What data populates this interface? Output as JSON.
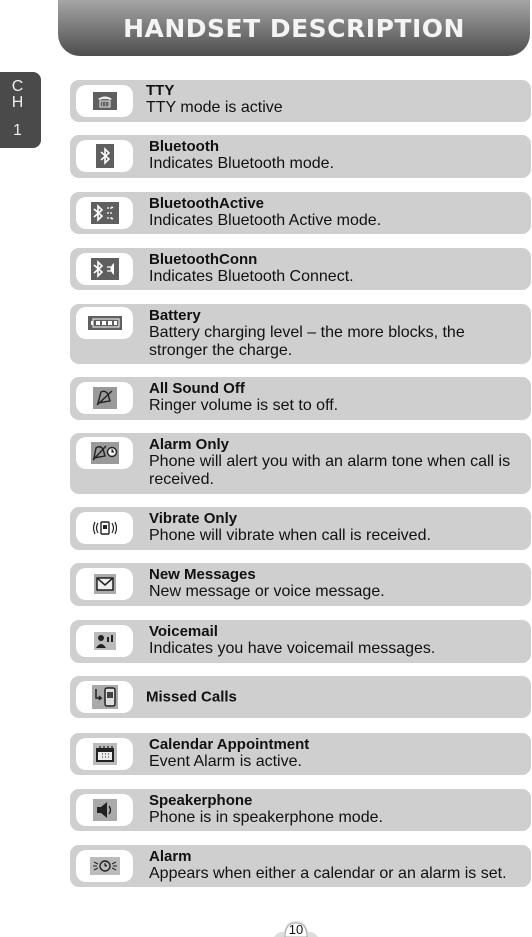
{
  "header": {
    "title": "HANDSET DESCRIPTION"
  },
  "chapter_tab": {
    "line1": "C",
    "line2": "H",
    "line3": "1"
  },
  "items": [
    {
      "icon": "tty-icon",
      "title": "TTY",
      "desc": "TTY mode is active"
    },
    {
      "icon": "bluetooth-icon",
      "title": "Bluetooth",
      "desc": "Indicates Bluetooth mode."
    },
    {
      "icon": "bluetooth-active-icon",
      "title": "BluetoothActive",
      "desc": "Indicates Bluetooth Active mode."
    },
    {
      "icon": "bluetooth-connect-icon",
      "title": "BluetoothConn",
      "desc": "Indicates Bluetooth Connect."
    },
    {
      "icon": "battery-icon",
      "title": "Battery",
      "desc": "Battery charging level – the more blocks, the stronger the charge."
    },
    {
      "icon": "all-sound-off-icon",
      "title": "All Sound Off",
      "desc": "Ringer volume is set to off."
    },
    {
      "icon": "alarm-only-icon",
      "title": "Alarm Only",
      "desc": "Phone will alert you with an alarm tone when call is received."
    },
    {
      "icon": "vibrate-only-icon",
      "title": "Vibrate Only",
      "desc": "Phone will vibrate when call is received."
    },
    {
      "icon": "new-message-icon",
      "title": "New Messages",
      "desc": "New message or voice message."
    },
    {
      "icon": "voicemail-icon",
      "title": "Voicemail",
      "desc": "Indicates you have voicemail messages."
    },
    {
      "icon": "missed-calls-icon",
      "title": "Missed Calls",
      "desc": ""
    },
    {
      "icon": "calendar-icon",
      "title": "Calendar Appointment",
      "desc": "Event Alarm is active."
    },
    {
      "icon": "speakerphone-icon",
      "title": "Speakerphone",
      "desc": "Phone is in speakerphone mode."
    },
    {
      "icon": "alarm-clock-icon",
      "title": "Alarm",
      "desc": "Appears when either a calendar or an alarm is set."
    }
  ],
  "page_number": "10"
}
